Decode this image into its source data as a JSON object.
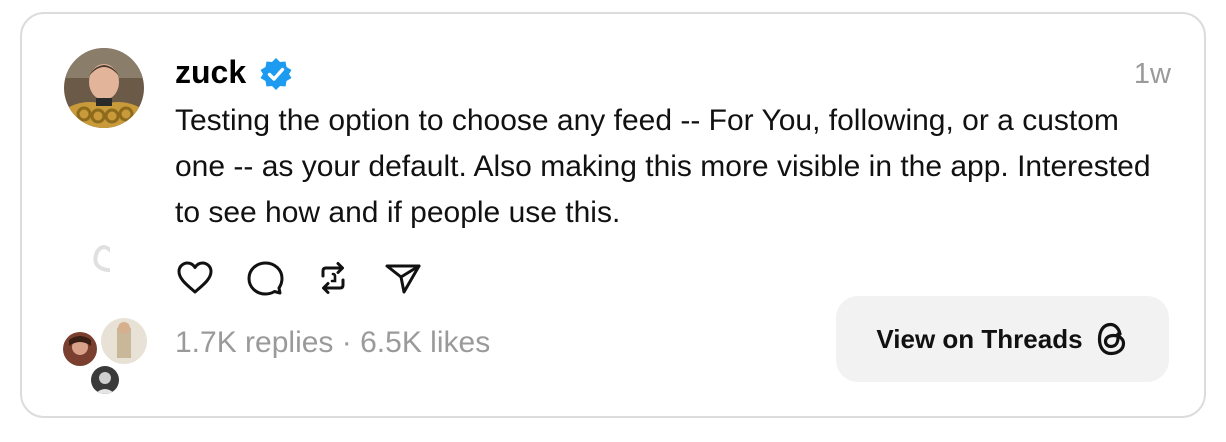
{
  "post": {
    "username": "zuck",
    "verified_icon": "verified-badge-icon",
    "time": "1w",
    "text": "Testing the option to choose any feed -- For You, following, or a custom one -- as your default. Also making this more visible in the app. Interested to see how and if people use this.",
    "replies": "1.7K replies",
    "separator": "·",
    "likes": "6.5K likes"
  },
  "actions": {
    "icons": [
      "heart-icon",
      "comment-icon",
      "repost-icon",
      "share-icon"
    ]
  },
  "cta": {
    "label": "View on Threads",
    "icon": "threads-logo-icon"
  },
  "colors": {
    "verified": "#1d9bf0",
    "muted": "#9a9a9a",
    "button_bg": "#f2f2f2",
    "border": "#dcdcdc"
  }
}
